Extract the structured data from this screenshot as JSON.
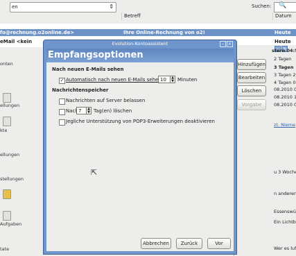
{
  "app": {
    "folder_combo": "en",
    "search_label": "Suchen:",
    "columns": {
      "subject": "Betreff",
      "date": "Datum"
    },
    "messages": [
      {
        "from": "fo@rechnung.o2online.de>",
        "subject": "Ihre Online-Rechnung von o2!",
        "date": "Heute 15:41"
      },
      {
        "from": "eMail <kein",
        "subject": "",
        "date": "Heute 04:58"
      }
    ],
    "sidebar": [
      "onten",
      "ellungen",
      "kte",
      "ellungen",
      "stellungen",
      "Aufgaben",
      "tate"
    ],
    "right_texts": [
      "stern 04:5",
      "2 Tagen",
      "3 Tagen",
      "3 Tagen 21",
      "4 Tagen 06",
      "08.2010 00",
      "08.2010 18",
      "08.2010 01",
      "zt. Nieme",
      "u 3 Wocher",
      "n anderen",
      "Essenswün",
      "Ein Lichtbl",
      "Wer es luf"
    ]
  },
  "behind_dialog": {
    "buttons": [
      "Hinzufügen",
      "Bearbeiten",
      "Löschen",
      "Vorgabe"
    ]
  },
  "dialog": {
    "window_title": "Evolution-Kontoassistent",
    "header": "Empfangsoptionen",
    "section1": "Nach neuen E-Mails sehen",
    "auto_check_label": "Automatisch nach neuen E-Mails sehen alle",
    "auto_check_value": "10",
    "auto_check_unit": "Minuten",
    "section2": "Nachrichtenspeicher",
    "leave_on_server": "Nachrichten auf Server belassen",
    "delete_after_label": "Nach",
    "delete_after_value": "7",
    "delete_after_unit": "Tag(en) löschen",
    "disable_pop3": "Jegliche Unterstützung von POP3-Erweiterungen deaktivieren",
    "buttons": {
      "cancel": "Abbrechen",
      "back": "Zurück",
      "forward": "Vor"
    }
  }
}
